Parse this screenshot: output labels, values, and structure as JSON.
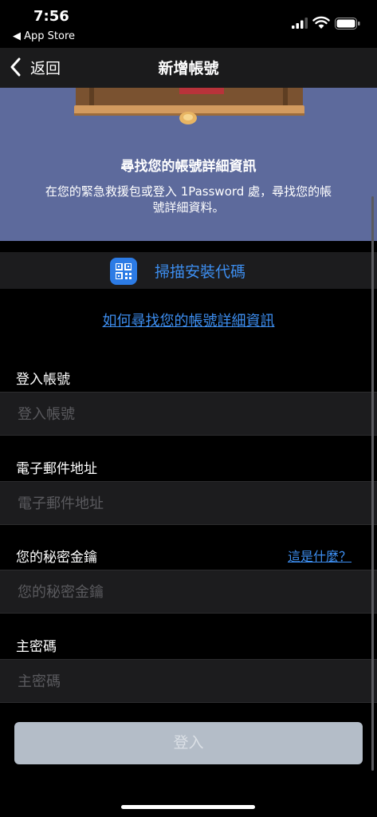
{
  "status_bar": {
    "time": "7:56",
    "back_app": "◀ App Store"
  },
  "nav": {
    "back_label": "返回",
    "title": "新增帳號"
  },
  "header": {
    "title": "尋找您的帳號詳細資訊",
    "description": "在您的緊急救援包或登入 1Password 處，尋找您的帳號詳細資料。"
  },
  "scan": {
    "label": "掃描安裝代碼",
    "icon": "qr-code-icon"
  },
  "help_link": "如何尋找您的帳號詳細資訊",
  "fields": [
    {
      "label": "登入帳號",
      "placeholder": "登入帳號"
    },
    {
      "label": "電子郵件地址",
      "placeholder": "電子郵件地址"
    },
    {
      "label": "您的秘密金鑰",
      "placeholder": "您的秘密金鑰"
    },
    {
      "label": "主密碼",
      "placeholder": "主密碼"
    }
  ],
  "whats_this": "這是什麼？",
  "signin_label": "登入",
  "colors": {
    "header_bg": "#5d6a9c",
    "accent": "#3d8ef0",
    "button_disabled": "#b4bdc8"
  }
}
